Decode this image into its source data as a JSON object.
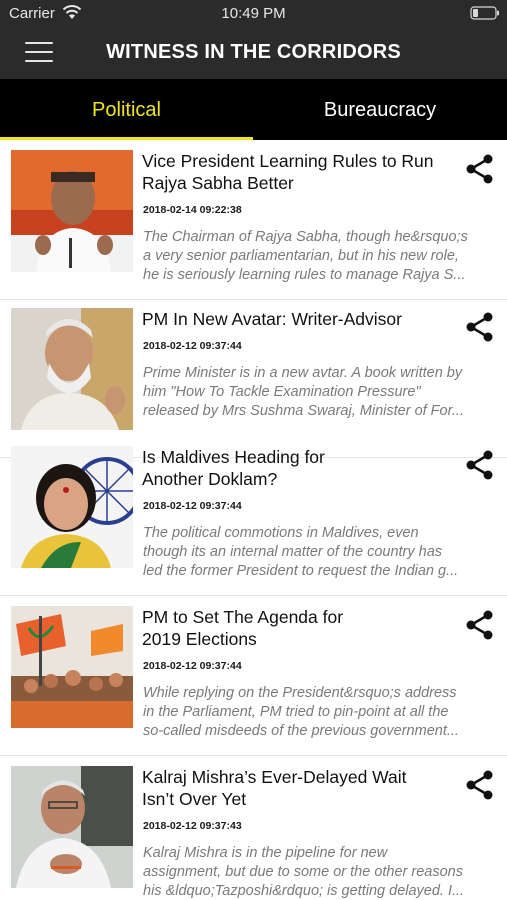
{
  "status_bar": {
    "carrier": "Carrier",
    "time": "10:49 PM"
  },
  "header": {
    "title": "WITNESS IN THE CORRIDORS"
  },
  "tabs": [
    {
      "label": "Political",
      "active": true
    },
    {
      "label": "Bureaucracy",
      "active": false
    }
  ],
  "colors": {
    "accent": "#f1e61e",
    "header_bg": "#2b2b2b",
    "tab_bg": "#000000"
  },
  "articles": [
    {
      "title_lines": [
        "Vice President Learning Rules to Run",
        "Rajya Sabha Better"
      ],
      "date": "2018-02-14 09:22:38",
      "excerpt_lines": [
        "The Chairman of Rajya Sabha, though he&rsquo;s",
        "a very senior parliamentarian, but in his new role,",
        "he is seriously learning rules to manage Rajya S..."
      ]
    },
    {
      "title_lines": [
        "PM In New Avatar: Writer-Advisor"
      ],
      "date": "2018-02-12 09:37:44",
      "excerpt_lines": [
        "Prime Minister is in a new avtar. A book written by",
        "him \"How To Tackle Examination Pressure\"",
        "released by Mrs Sushma Swaraj, Minister of For..."
      ]
    },
    {
      "title_lines": [
        "Is Maldives Heading for",
        "Another Doklam?"
      ],
      "date": "2018-02-12 09:37:44",
      "excerpt_lines": [
        "The political commotions in Maldives, even",
        "though its an internal matter of the country has",
        "led the former President to request the Indian g..."
      ]
    },
    {
      "title_lines": [
        "PM to Set The Agenda for",
        "2019 Elections"
      ],
      "date": "2018-02-12 09:37:44",
      "excerpt_lines": [
        "While replying on the President&rsquo;s address",
        "in the Parliament, PM tried to pin-point at all the",
        "so-called misdeeds of the previous government..."
      ]
    },
    {
      "title_lines": [
        "Kalraj Mishra’s Ever-Delayed Wait",
        "Isn’t Over Yet"
      ],
      "date": "2018-02-12 09:37:43",
      "excerpt_lines": [
        "Kalraj Mishra is in the pipeline for new",
        "assignment, but due to some or the other reasons",
        "his &ldquo;Tazposhi&rdquo; is getting delayed. I..."
      ]
    }
  ],
  "icons": {
    "menu": "hamburger-menu-icon",
    "share": "share-icon",
    "wifi": "wifi-icon",
    "battery": "battery-icon"
  }
}
